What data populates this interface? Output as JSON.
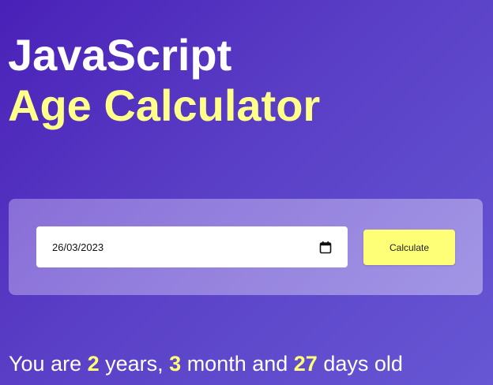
{
  "title": {
    "line1": "JavaScript",
    "line2": "Age Calculator"
  },
  "form": {
    "date_value": "26/03/2023",
    "calculate_label": "Calculate",
    "calendar_icon": "calendar-icon"
  },
  "result": {
    "prefix": "You are ",
    "years": "2",
    "years_label": " years, ",
    "months": "3",
    "months_label": " month and ",
    "days": "27",
    "days_label": " days old"
  },
  "colors": {
    "background_start": "#4a20b8",
    "background_end": "#6657d4",
    "accent_yellow": "#ffff8a",
    "button_yellow": "#ffff77"
  }
}
